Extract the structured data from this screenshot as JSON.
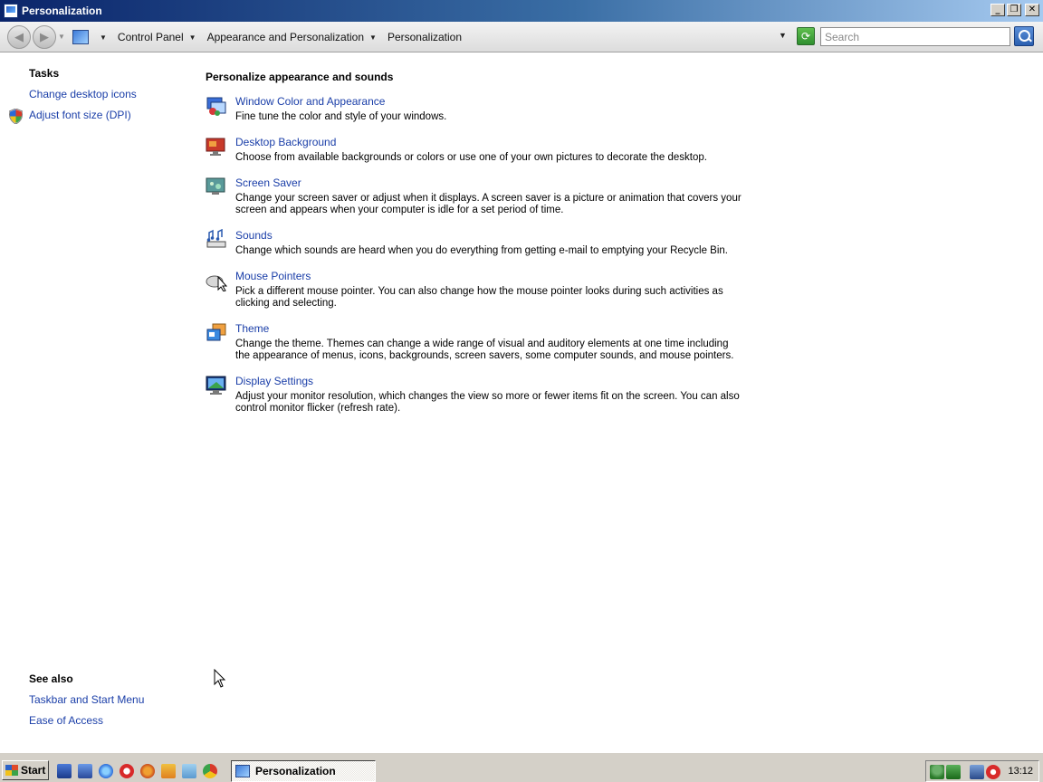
{
  "window": {
    "title": "Personalization",
    "controls": {
      "minimize": "_",
      "restore": "❐",
      "close": "✕"
    }
  },
  "address_bar": {
    "breadcrumbs": [
      "Control Panel",
      "Appearance and Personalization",
      "Personalization"
    ],
    "search_placeholder": "Search"
  },
  "left_pane": {
    "tasks_heading": "Tasks",
    "tasks": [
      "Change desktop icons",
      "Adjust font size (DPI)"
    ],
    "see_also_heading": "See also",
    "see_also": [
      "Taskbar and Start Menu",
      "Ease of Access"
    ]
  },
  "main": {
    "heading": "Personalize appearance and sounds",
    "items": [
      {
        "title": "Window Color and Appearance",
        "description": "Fine tune the color and style of your windows.",
        "icon": "window-color-icon"
      },
      {
        "title": "Desktop Background",
        "description": "Choose from available backgrounds or colors or use one of your own pictures to decorate the desktop.",
        "icon": "desktop-background-icon"
      },
      {
        "title": "Screen Saver",
        "description": "Change your screen saver or adjust when it displays. A screen saver is a picture or animation that covers your screen and appears when your computer is idle for a set period of time.",
        "icon": "screen-saver-icon"
      },
      {
        "title": "Sounds",
        "description": "Change which sounds are heard when you do everything from getting e-mail to emptying your Recycle Bin.",
        "icon": "sounds-icon"
      },
      {
        "title": "Mouse Pointers",
        "description": "Pick a different mouse pointer. You can also change how the mouse pointer looks during such activities as clicking and selecting.",
        "icon": "mouse-pointers-icon"
      },
      {
        "title": "Theme",
        "description": "Change the theme. Themes can change a wide range of visual and auditory elements at one time including the appearance of menus, icons, backgrounds, screen savers, some computer sounds, and mouse pointers.",
        "icon": "theme-icon"
      },
      {
        "title": "Display Settings",
        "description": "Adjust your monitor resolution, which changes the view so more or fewer items fit on the screen. You can also control monitor flicker (refresh rate).",
        "icon": "display-settings-icon"
      }
    ]
  },
  "taskbar": {
    "start_label": "Start",
    "active_task": "Personalization",
    "clock": "13:12"
  },
  "colors": {
    "link": "#1a3ea8",
    "title_bar_start": "#0a246a",
    "title_bar_end": "#a6caf0",
    "taskbar": "#d4d0c8"
  }
}
